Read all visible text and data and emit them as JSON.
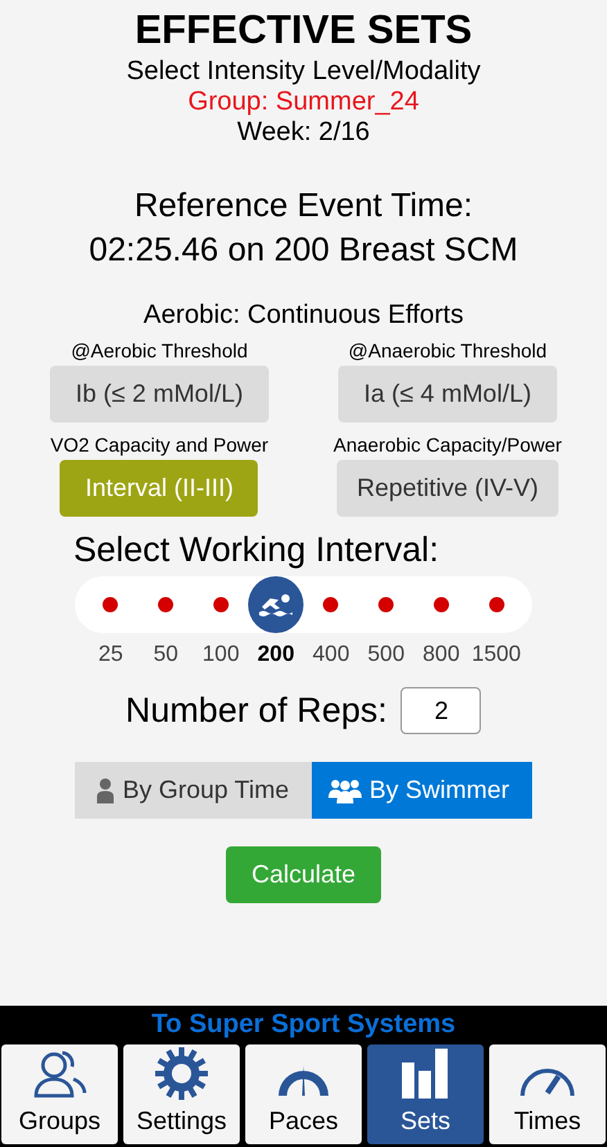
{
  "header": {
    "title": "EFFECTIVE SETS",
    "subtitle": "Select Intensity Level/Modality",
    "group": "Group: Summer_24",
    "week": "Week: 2/16"
  },
  "reference": {
    "label": "Reference Event Time:",
    "value": "02:25.46 on 200 Breast SCM"
  },
  "aerobic_heading": "Aerobic: Continuous Efforts",
  "intensities": [
    {
      "caption": "@Aerobic Threshold",
      "label": "Ib (≤ 2 mMol/L)",
      "selected": false
    },
    {
      "caption": "@Anaerobic Threshold",
      "label": "Ia (≤ 4 mMol/L)",
      "selected": false
    },
    {
      "caption": "VO2 Capacity and Power",
      "label": "Interval (II-III)",
      "selected": true
    },
    {
      "caption": "Anaerobic Capacity/Power",
      "label": "Repetitive (IV-V)",
      "selected": false
    }
  ],
  "interval": {
    "label": "Select Working Interval:",
    "stops": [
      {
        "label": "25",
        "selected": false
      },
      {
        "label": "50",
        "selected": false
      },
      {
        "label": "100",
        "selected": false
      },
      {
        "label": "200",
        "selected": true
      },
      {
        "label": "400",
        "selected": false
      },
      {
        "label": "500",
        "selected": false
      },
      {
        "label": "800",
        "selected": false
      },
      {
        "label": "1500",
        "selected": false
      }
    ]
  },
  "reps": {
    "label": "Number of Reps:",
    "value": "2"
  },
  "mode_toggle": [
    {
      "label": "By Group Time",
      "kind": "person",
      "selected": false
    },
    {
      "label": "By Swimmer",
      "kind": "people",
      "selected": true
    }
  ],
  "calculate_button": "Calculate",
  "footer_link": "To Super Sport Systems",
  "nav": [
    {
      "label": "Groups",
      "kind": "groups",
      "selected": false
    },
    {
      "label": "Settings",
      "kind": "settings",
      "selected": false
    },
    {
      "label": "Paces",
      "kind": "paces",
      "selected": false
    },
    {
      "label": "Sets",
      "kind": "sets",
      "selected": true
    },
    {
      "label": "Times",
      "kind": "times",
      "selected": false
    }
  ]
}
